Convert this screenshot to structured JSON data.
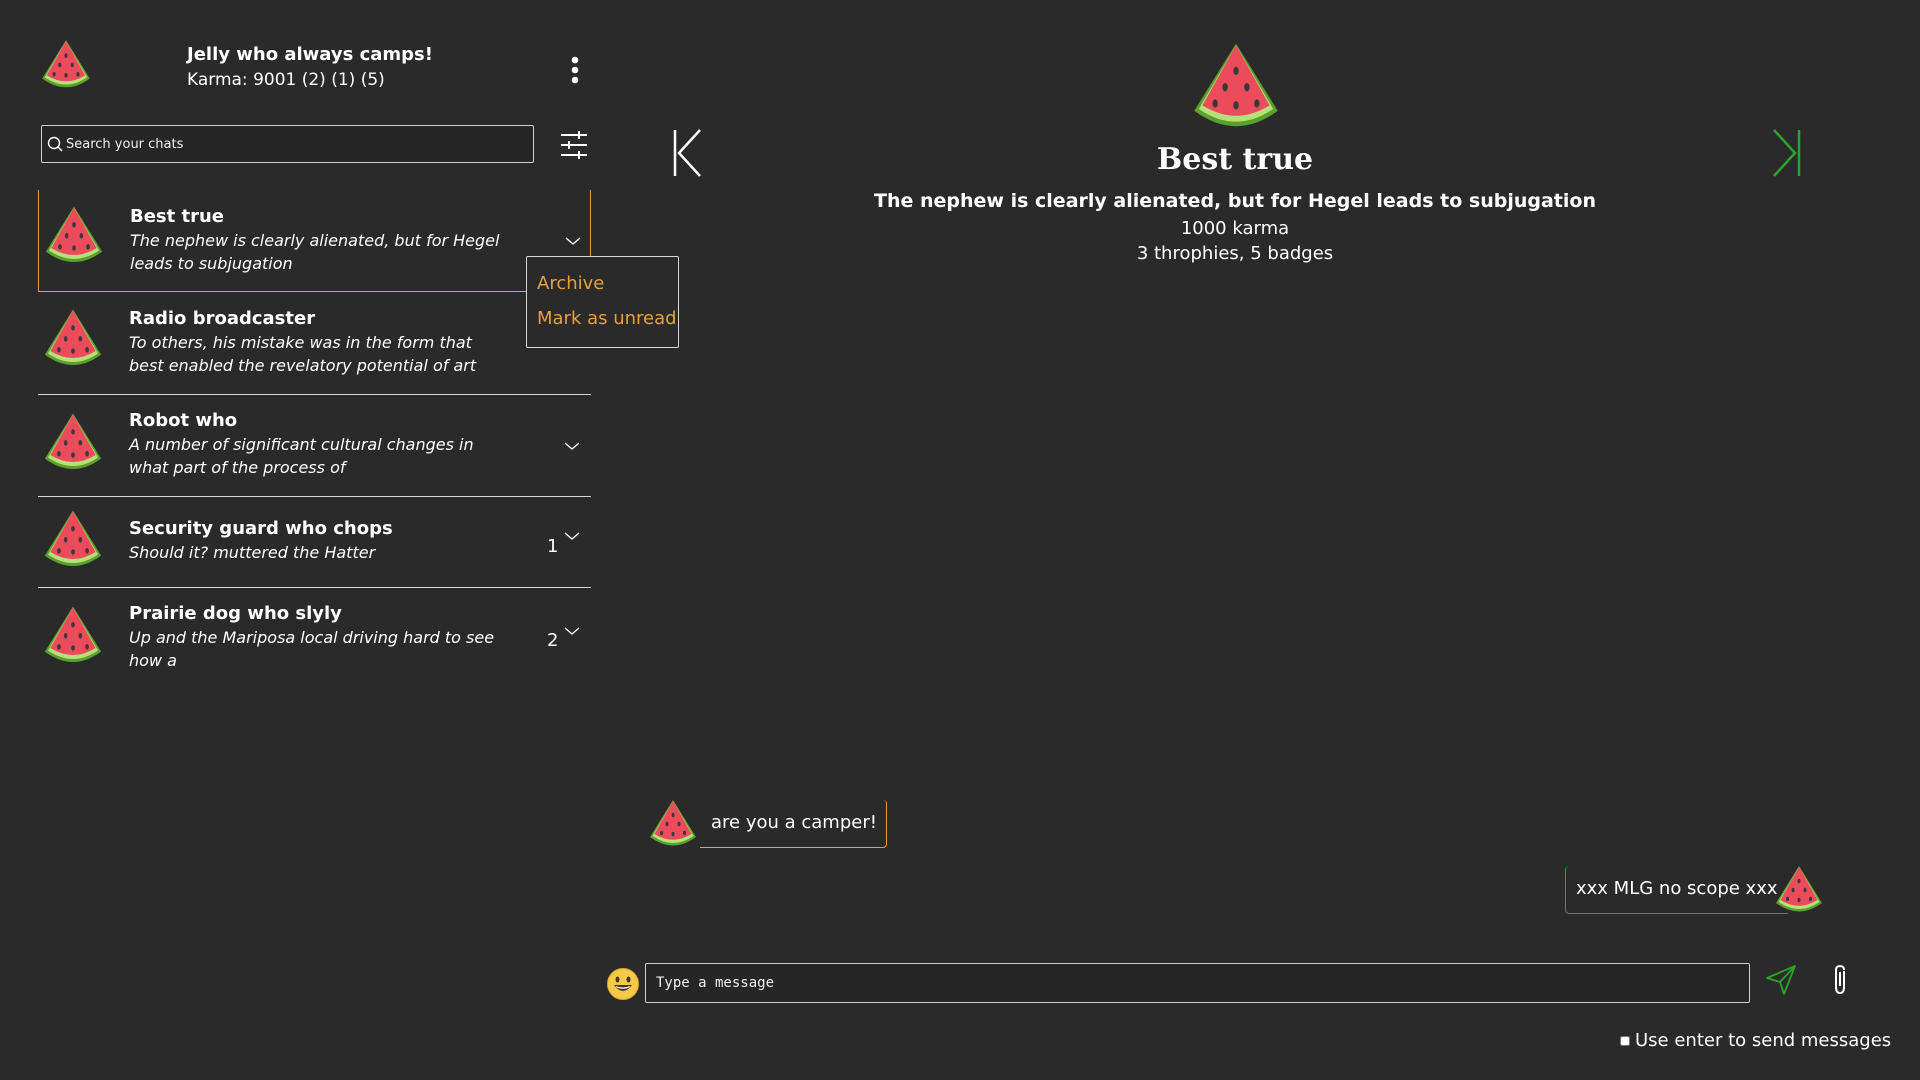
{
  "profile": {
    "name": "Jelly who always camps!",
    "karma_line": "Karma: 9001 (2) (1) (5)",
    "avatar_icon": "watermelon-icon"
  },
  "search": {
    "placeholder": "Search your chats",
    "value": ""
  },
  "chats": [
    {
      "name": "Best true",
      "preview": "The nephew is clearly alienated, but for Hegel leads to subjugation",
      "unread": "",
      "selected": true
    },
    {
      "name": "Radio broadcaster",
      "preview": "To others, his mistake was in the form that best enabled the revelatory potential of art",
      "unread": ""
    },
    {
      "name": "Robot who",
      "preview": "A number of significant cultural changes in what part of the process of",
      "unread": ""
    },
    {
      "name": "Security guard who chops",
      "preview": "Should it? muttered the Hatter",
      "unread": "1"
    },
    {
      "name": "Prairie dog who slyly",
      "preview": "Up and the Mariposa local driving hard to see how a",
      "unread": "2"
    }
  ],
  "chat_menu": {
    "archive": "Archive",
    "mark_unread": "Mark as unread"
  },
  "contact": {
    "name": "Best true",
    "status": "The nephew is clearly alienated, but for Hegel leads to subjugation",
    "karma": "1000 karma",
    "trophies": "3 throphies, 5 badges"
  },
  "messages": [
    {
      "direction": "incoming",
      "text": "are you a camper!"
    },
    {
      "direction": "outgoing",
      "text": "xxx MLG no scope xxx"
    }
  ],
  "composer": {
    "placeholder": "Type a message",
    "value": "",
    "enter_to_send_label": "Use enter to send messages",
    "enter_to_send_checked": false
  },
  "colors": {
    "background": "#2a2a2a",
    "accent_orange": "#e8a13a",
    "accent_green": "#2aa52a",
    "watermelon_red": "#ec4b5c",
    "rind_green": "#7bbf3a"
  }
}
